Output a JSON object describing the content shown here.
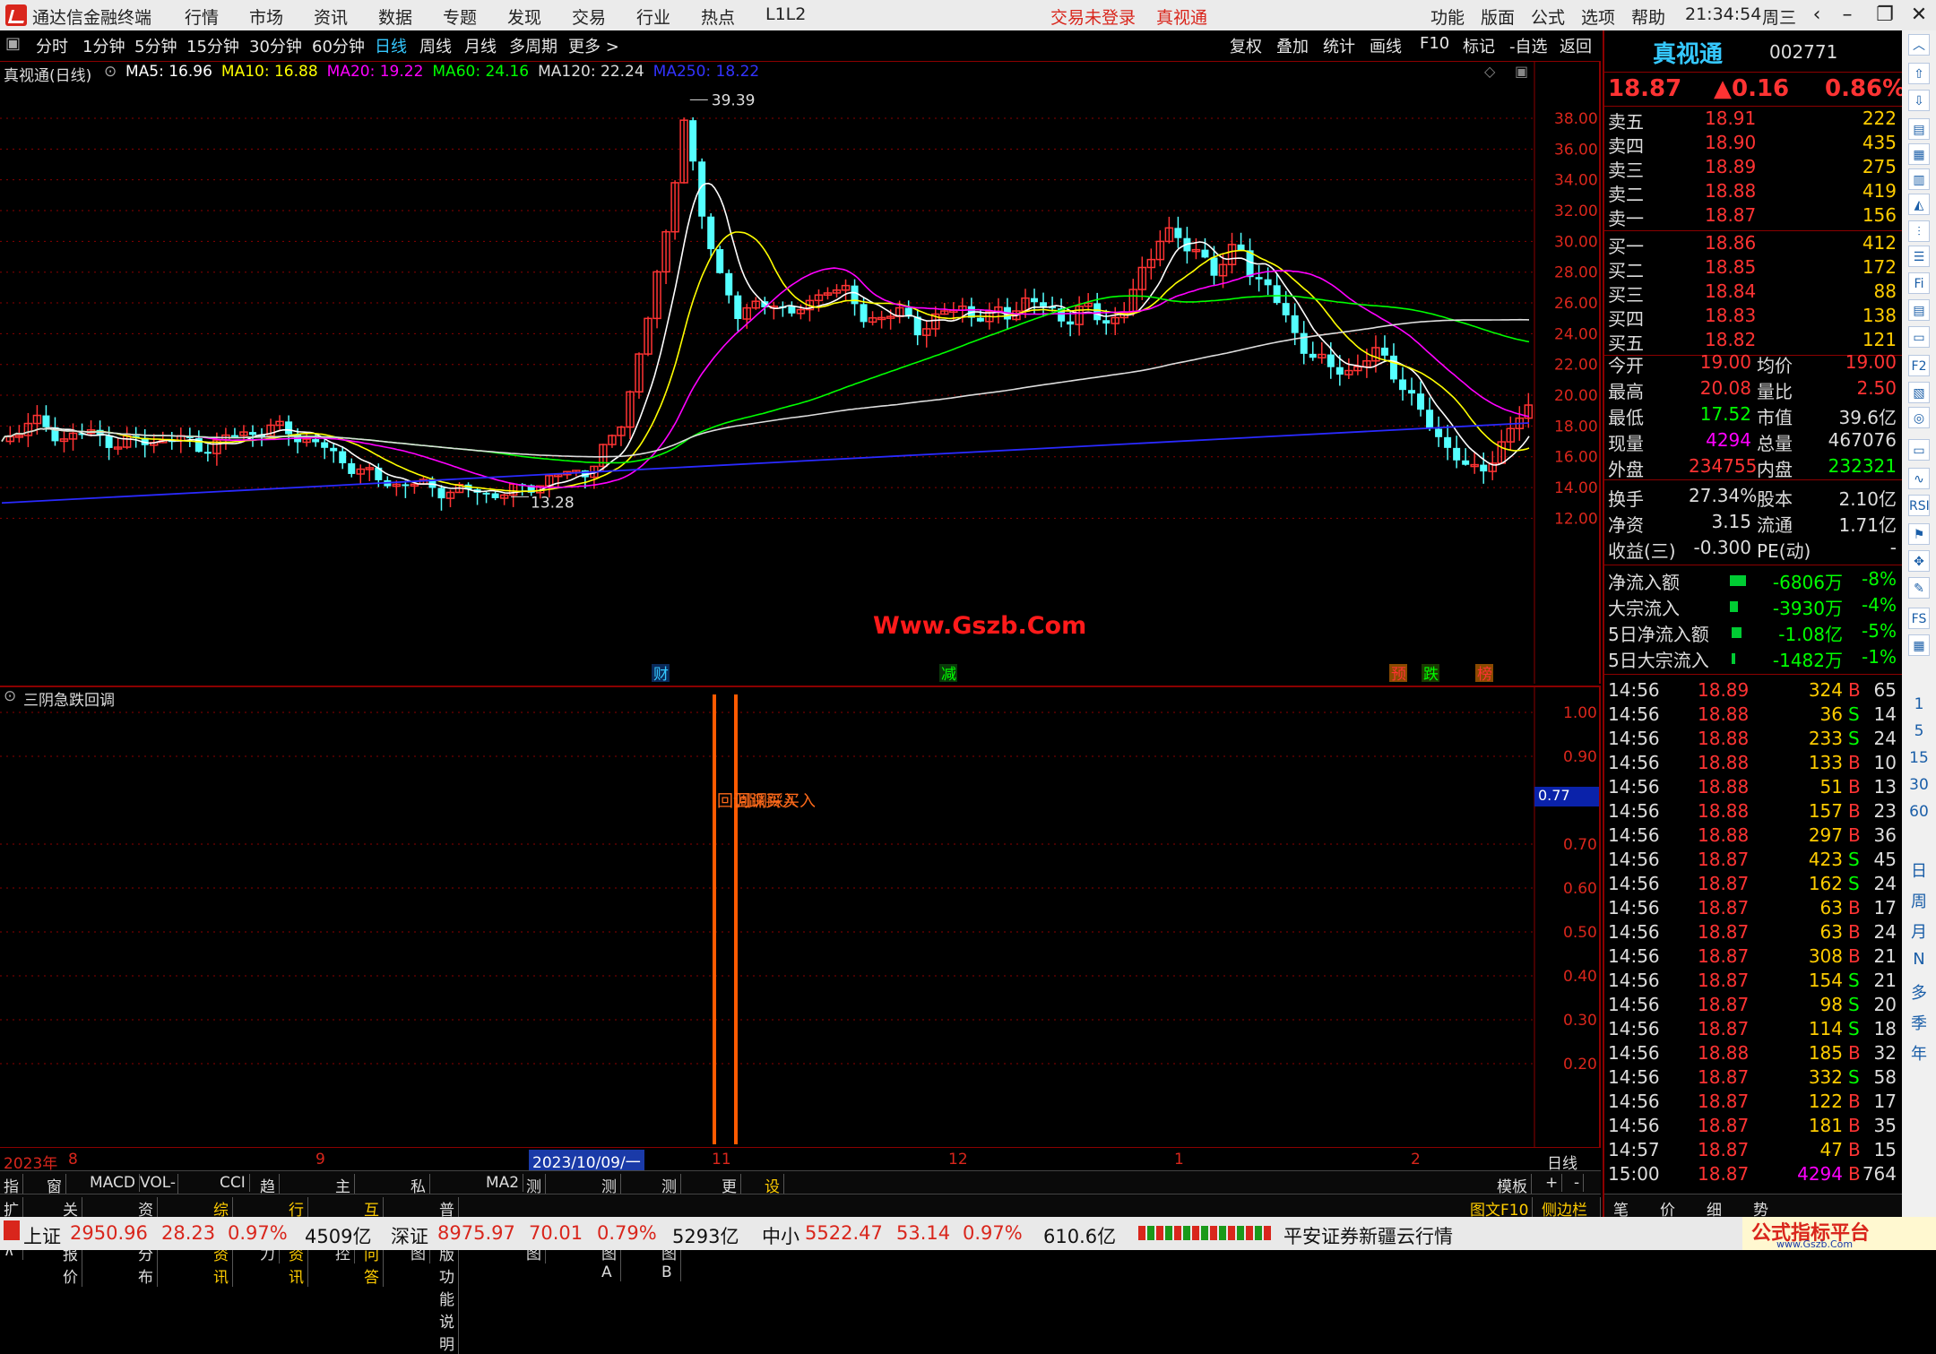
{
  "titlebar": {
    "app_name": "通达信金融终端",
    "menus": [
      "行情",
      "市场",
      "资讯",
      "数据",
      "专题",
      "发现",
      "交易",
      "行业",
      "热点",
      "L1L2"
    ],
    "status_login": "交易未登录",
    "stock_name_red": "真视通",
    "right_menus": [
      "功能",
      "版面",
      "公式",
      "选项",
      "帮助"
    ],
    "time": "21:34:54",
    "weekday": "周三"
  },
  "toolbar": {
    "periods": [
      "分时",
      "1分钟",
      "5分钟",
      "15分钟",
      "30分钟",
      "60分钟",
      "日线",
      "周线",
      "月线",
      "多周期",
      "更多 >"
    ],
    "active_period": "日线",
    "right_buttons": [
      "复权",
      "叠加",
      "统计",
      "画线",
      "F10",
      "标记",
      "-自选",
      "返回"
    ]
  },
  "chart": {
    "title": "真视通(日线)",
    "ma_legend": [
      {
        "label": "MA5: 16.96",
        "color": "#ffffff"
      },
      {
        "label": "MA10: 16.88",
        "color": "#ffff00"
      },
      {
        "label": "MA20: 19.22",
        "color": "#ff00ff"
      },
      {
        "label": "MA60: 24.16",
        "color": "#00ff00"
      },
      {
        "label": "MA120: 22.24",
        "color": "#dddddd"
      },
      {
        "label": "MA250: 18.22",
        "color": "#3333ff"
      }
    ],
    "y_ticks": [
      "38.00",
      "36.00",
      "34.00",
      "32.00",
      "30.00",
      "28.00",
      "26.00",
      "24.00",
      "22.00",
      "20.00",
      "18.00",
      "16.00",
      "14.00",
      "12.00"
    ],
    "high_label": "39.39",
    "low_label": "13.28",
    "watermark": "Www.Gszb.Com",
    "event_markers": [
      {
        "text": "财",
        "color": "#35c8ff",
        "bg": "#0a2a5a"
      },
      {
        "text": "减",
        "color": "#00ff00",
        "bg": "#0a3a0a"
      },
      {
        "text": "预",
        "color": "#ff3333",
        "bg": "#8a4a00"
      },
      {
        "text": "跌",
        "color": "#00ff00",
        "bg": "#1a3a00"
      },
      {
        "text": "榜",
        "color": "#ff3333",
        "bg": "#8a4a00"
      }
    ]
  },
  "indicator": {
    "title": "三阴急跌回调",
    "y_ticks": [
      "1.00",
      "0.90",
      "0.70",
      "0.60",
      "0.50",
      "0.40",
      "0.30",
      "0.20"
    ],
    "current_value": "0.77",
    "signal_text": "回调踩买入"
  },
  "datebar": {
    "labels": [
      "2023年",
      "8",
      "9",
      "2023/10/09/一",
      "11",
      "12",
      "1",
      "2"
    ],
    "right_label": "日线"
  },
  "tabbar1": {
    "tabs": [
      "指标",
      "窗口",
      "MACD",
      "VOL-TDX",
      "CCI",
      "趋势动力",
      "主力监控",
      "私募主图",
      "MA2",
      "测试主图",
      "测试幅图A",
      "测试幅图B",
      "更多",
      "设置"
    ],
    "right": [
      "模板",
      "+",
      "-"
    ]
  },
  "tabbar2": {
    "tabs": [
      "扩展∧",
      "关联报价",
      "资金分布",
      "综合资讯",
      "行业资讯",
      "互动问答",
      "普及版功能说明"
    ],
    "right": [
      "图文F10",
      "侧边栏 《"
    ],
    "right_tabs": [
      "笔",
      "价",
      "细",
      "势"
    ]
  },
  "statusbar": {
    "items": [
      {
        "name": "上证",
        "price": "2950.96",
        "chg": "28.23",
        "pct": "0.97%",
        "amt": "4509亿"
      },
      {
        "name": "深证",
        "price": "8975.97",
        "chg": "70.01",
        "pct": "0.79%",
        "amt": "5293亿"
      },
      {
        "name": "中小",
        "price": "5522.47",
        "chg": "53.14",
        "pct": "0.97%",
        "amt": "610.6亿"
      }
    ],
    "broker": "平安证券新疆云行情",
    "logo_text": "公式指标平台",
    "logo_url": "www.Gszb.Com"
  },
  "quote": {
    "name": "真视通",
    "code": "002771",
    "price": "18.87",
    "change": "▲0.16",
    "pct": "0.86%",
    "asks": [
      {
        "label": "卖五",
        "price": "18.91",
        "vol": "222"
      },
      {
        "label": "卖四",
        "price": "18.90",
        "vol": "435"
      },
      {
        "label": "卖三",
        "price": "18.89",
        "vol": "275"
      },
      {
        "label": "卖二",
        "price": "18.88",
        "vol": "419"
      },
      {
        "label": "卖一",
        "price": "18.87",
        "vol": "156"
      }
    ],
    "bids": [
      {
        "label": "买一",
        "price": "18.86",
        "vol": "412"
      },
      {
        "label": "买二",
        "price": "18.85",
        "vol": "172"
      },
      {
        "label": "买三",
        "price": "18.84",
        "vol": "88"
      },
      {
        "label": "买四",
        "price": "18.83",
        "vol": "138"
      },
      {
        "label": "买五",
        "price": "18.82",
        "vol": "121"
      }
    ],
    "stats": [
      {
        "l1": "今开",
        "v1": "19.00",
        "c1": "#ff3333",
        "l2": "均价",
        "v2": "19.00",
        "c2": "#ff3333"
      },
      {
        "l1": "最高",
        "v1": "20.08",
        "c1": "#ff3333",
        "l2": "量比",
        "v2": "2.50",
        "c2": "#ff3333"
      },
      {
        "l1": "最低",
        "v1": "17.52",
        "c1": "#00ff00",
        "l2": "市值",
        "v2": "39.6亿",
        "c2": "#dddddd"
      },
      {
        "l1": "现量",
        "v1": "4294",
        "c1": "#ff00ff",
        "l2": "总量",
        "v2": "467076",
        "c2": "#dddddd"
      },
      {
        "l1": "外盘",
        "v1": "234755",
        "c1": "#ff3333",
        "l2": "内盘",
        "v2": "232321",
        "c2": "#00ff00"
      },
      {
        "l1": "换手",
        "v1": "27.34%",
        "c1": "#dddddd",
        "l2": "股本",
        "v2": "2.10亿",
        "c2": "#dddddd"
      },
      {
        "l1": "净资",
        "v1": "3.15",
        "c1": "#dddddd",
        "l2": "流通",
        "v2": "1.71亿",
        "c2": "#dddddd"
      },
      {
        "l1": "收益(三)",
        "v1": "-0.300",
        "c1": "#dddddd",
        "l2": "PE(动)",
        "v2": "-",
        "c2": "#dddddd"
      }
    ],
    "flows": [
      {
        "label": "净流入额",
        "val": "-6806万",
        "pct": "-8%",
        "bar": 0.8
      },
      {
        "label": "大宗流入",
        "val": "-3930万",
        "pct": "-4%",
        "bar": 0.4
      },
      {
        "label": "5日净流入额",
        "val": "-1.08亿",
        "pct": "-5%",
        "bar": 0.5
      },
      {
        "label": "5日大宗流入",
        "val": "-1482万",
        "pct": "-1%",
        "bar": 0.1
      }
    ],
    "ticks": [
      {
        "t": "14:56",
        "p": "18.89",
        "v": "324",
        "d": "B",
        "n": "65"
      },
      {
        "t": "14:56",
        "p": "18.88",
        "v": "36",
        "d": "S",
        "n": "14"
      },
      {
        "t": "14:56",
        "p": "18.88",
        "v": "233",
        "d": "S",
        "n": "24"
      },
      {
        "t": "14:56",
        "p": "18.88",
        "v": "133",
        "d": "B",
        "n": "10"
      },
      {
        "t": "14:56",
        "p": "18.88",
        "v": "51",
        "d": "B",
        "n": "13"
      },
      {
        "t": "14:56",
        "p": "18.88",
        "v": "157",
        "d": "B",
        "n": "23"
      },
      {
        "t": "14:56",
        "p": "18.88",
        "v": "297",
        "d": "B",
        "n": "36"
      },
      {
        "t": "14:56",
        "p": "18.87",
        "v": "423",
        "d": "S",
        "n": "45"
      },
      {
        "t": "14:56",
        "p": "18.87",
        "v": "162",
        "d": "S",
        "n": "24"
      },
      {
        "t": "14:56",
        "p": "18.87",
        "v": "63",
        "d": "B",
        "n": "17"
      },
      {
        "t": "14:56",
        "p": "18.87",
        "v": "63",
        "d": "B",
        "n": "24"
      },
      {
        "t": "14:56",
        "p": "18.87",
        "v": "308",
        "d": "B",
        "n": "21"
      },
      {
        "t": "14:56",
        "p": "18.87",
        "v": "154",
        "d": "S",
        "n": "21"
      },
      {
        "t": "14:56",
        "p": "18.87",
        "v": "98",
        "d": "S",
        "n": "20"
      },
      {
        "t": "14:56",
        "p": "18.87",
        "v": "114",
        "d": "S",
        "n": "18"
      },
      {
        "t": "14:56",
        "p": "18.88",
        "v": "185",
        "d": "B",
        "n": "32"
      },
      {
        "t": "14:56",
        "p": "18.87",
        "v": "332",
        "d": "S",
        "n": "58"
      },
      {
        "t": "14:56",
        "p": "18.87",
        "v": "122",
        "d": "B",
        "n": "17"
      },
      {
        "t": "14:56",
        "p": "18.87",
        "v": "181",
        "d": "B",
        "n": "35"
      },
      {
        "t": "14:57",
        "p": "18.87",
        "v": "47",
        "d": "B",
        "n": "15"
      },
      {
        "t": "15:00",
        "p": "18.87",
        "v": "4294",
        "d": "B",
        "n": "764"
      }
    ]
  },
  "sidebar": {
    "period_labels": [
      "日",
      "周",
      "月",
      "N",
      "多",
      "季",
      "年"
    ],
    "numbers": [
      "1",
      "5",
      "15",
      "30",
      "60"
    ]
  },
  "colors": {
    "up": "#ff3333",
    "down": "#54ffff",
    "frame": "#8b0000"
  }
}
